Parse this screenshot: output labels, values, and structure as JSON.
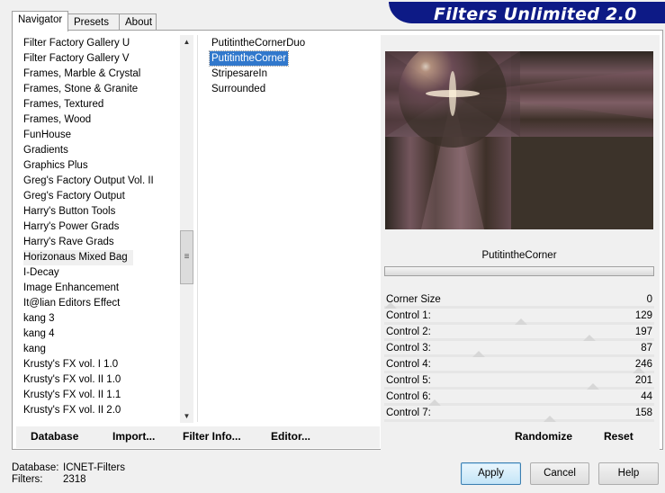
{
  "app": {
    "title": "Filters Unlimited 2.0"
  },
  "tabs": [
    {
      "label": "Navigator",
      "active": true
    },
    {
      "label": "Presets",
      "active": false
    },
    {
      "label": "About",
      "active": false
    }
  ],
  "categories": [
    "Filter Factory Gallery U",
    "Filter Factory Gallery V",
    "Frames, Marble & Crystal",
    "Frames, Stone & Granite",
    "Frames, Textured",
    "Frames, Wood",
    "FunHouse",
    "Gradients",
    "Graphics Plus",
    "Greg's Factory Output Vol. II",
    "Greg's Factory Output",
    "Harry's Button Tools",
    "Harry's Power Grads",
    "Harry's Rave Grads",
    "Horizonaus Mixed Bag",
    "I-Decay",
    "Image Enhancement",
    "It@lian Editors Effect",
    "kang 3",
    "kang 4",
    "kang",
    "Krusty's FX vol. I 1.0",
    "Krusty's FX vol. II 1.0",
    "Krusty's FX vol. II 1.1",
    "Krusty's FX vol. II 2.0"
  ],
  "selected_category": "Horizonaus Mixed Bag",
  "filters": [
    "PutitintheCornerDuo",
    "PutitintheCorner",
    "StripesareIn",
    "Surrounded"
  ],
  "selected_filter": "PutitintheCorner",
  "filter_panel": {
    "name": "PutitintheCorner",
    "controls": [
      {
        "label": "Corner Size",
        "value": "0"
      },
      {
        "label": "Control 1:",
        "value": "129"
      },
      {
        "label": "Control 2:",
        "value": "197"
      },
      {
        "label": "Control 3:",
        "value": "87"
      },
      {
        "label": "Control 4:",
        "value": "246"
      },
      {
        "label": "Control 5:",
        "value": "201"
      },
      {
        "label": "Control 6:",
        "value": "44"
      },
      {
        "label": "Control 7:",
        "value": "158"
      }
    ]
  },
  "toolbar": {
    "database": "Database",
    "import": "Import...",
    "filter_info": "Filter Info...",
    "editor": "Editor...",
    "randomize": "Randomize",
    "reset": "Reset"
  },
  "status": {
    "database_label": "Database:",
    "database_value": "ICNET-Filters",
    "filters_label": "Filters:",
    "filters_value": "2318"
  },
  "buttons": {
    "apply": "Apply",
    "cancel": "Cancel",
    "help": "Help"
  },
  "colors": {
    "banner": "#0d1a86",
    "selection": "#3178cc"
  }
}
